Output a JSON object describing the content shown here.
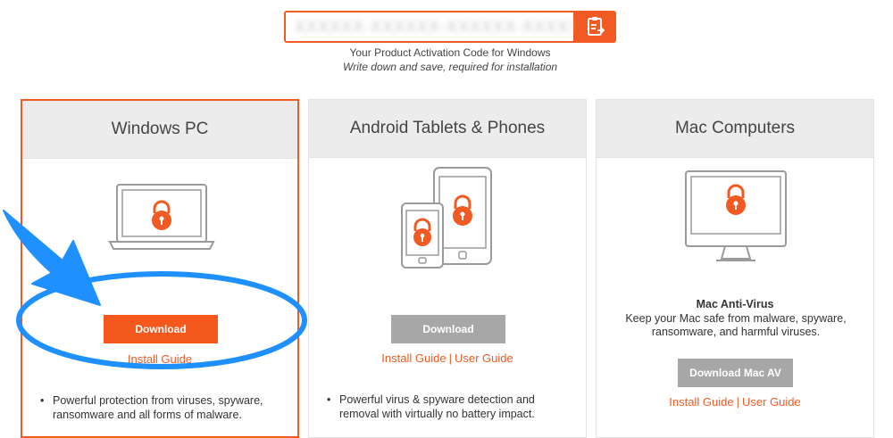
{
  "activation": {
    "code_masked": "XXXXXX-XXXXXX-XXXXXX-XXXXXX",
    "caption": "Your Product Activation Code for Windows",
    "subcaption": "Write down and save, required for installation",
    "copy_icon": "clipboard-copy-icon"
  },
  "cards": {
    "windows": {
      "title": "Windows PC",
      "download_label": "Download",
      "install_guide": "Install Guide",
      "bullet": "Powerful protection from viruses, spyware, ransomware and all forms of malware."
    },
    "android": {
      "title": "Android Tablets & Phones",
      "download_label": "Download",
      "install_guide": "Install Guide",
      "separator": "|",
      "user_guide": "User Guide",
      "bullet": "Powerful virus & spyware detection and removal with virtually no battery impact."
    },
    "mac": {
      "title": "Mac Computers",
      "product_name": "Mac Anti-Virus",
      "description": "Keep your Mac safe from malware, spyware, ransomware, and harmful viruses.",
      "download_label": "Download Mac AV",
      "install_guide": "Install Guide",
      "separator": "|",
      "user_guide": "User Guide"
    }
  },
  "colors": {
    "accent": "#f15a22",
    "button_orange": "#f4581c",
    "button_gray": "#a7a7a7",
    "header_bg": "#ececec",
    "annotation_blue": "#1e90ff"
  }
}
